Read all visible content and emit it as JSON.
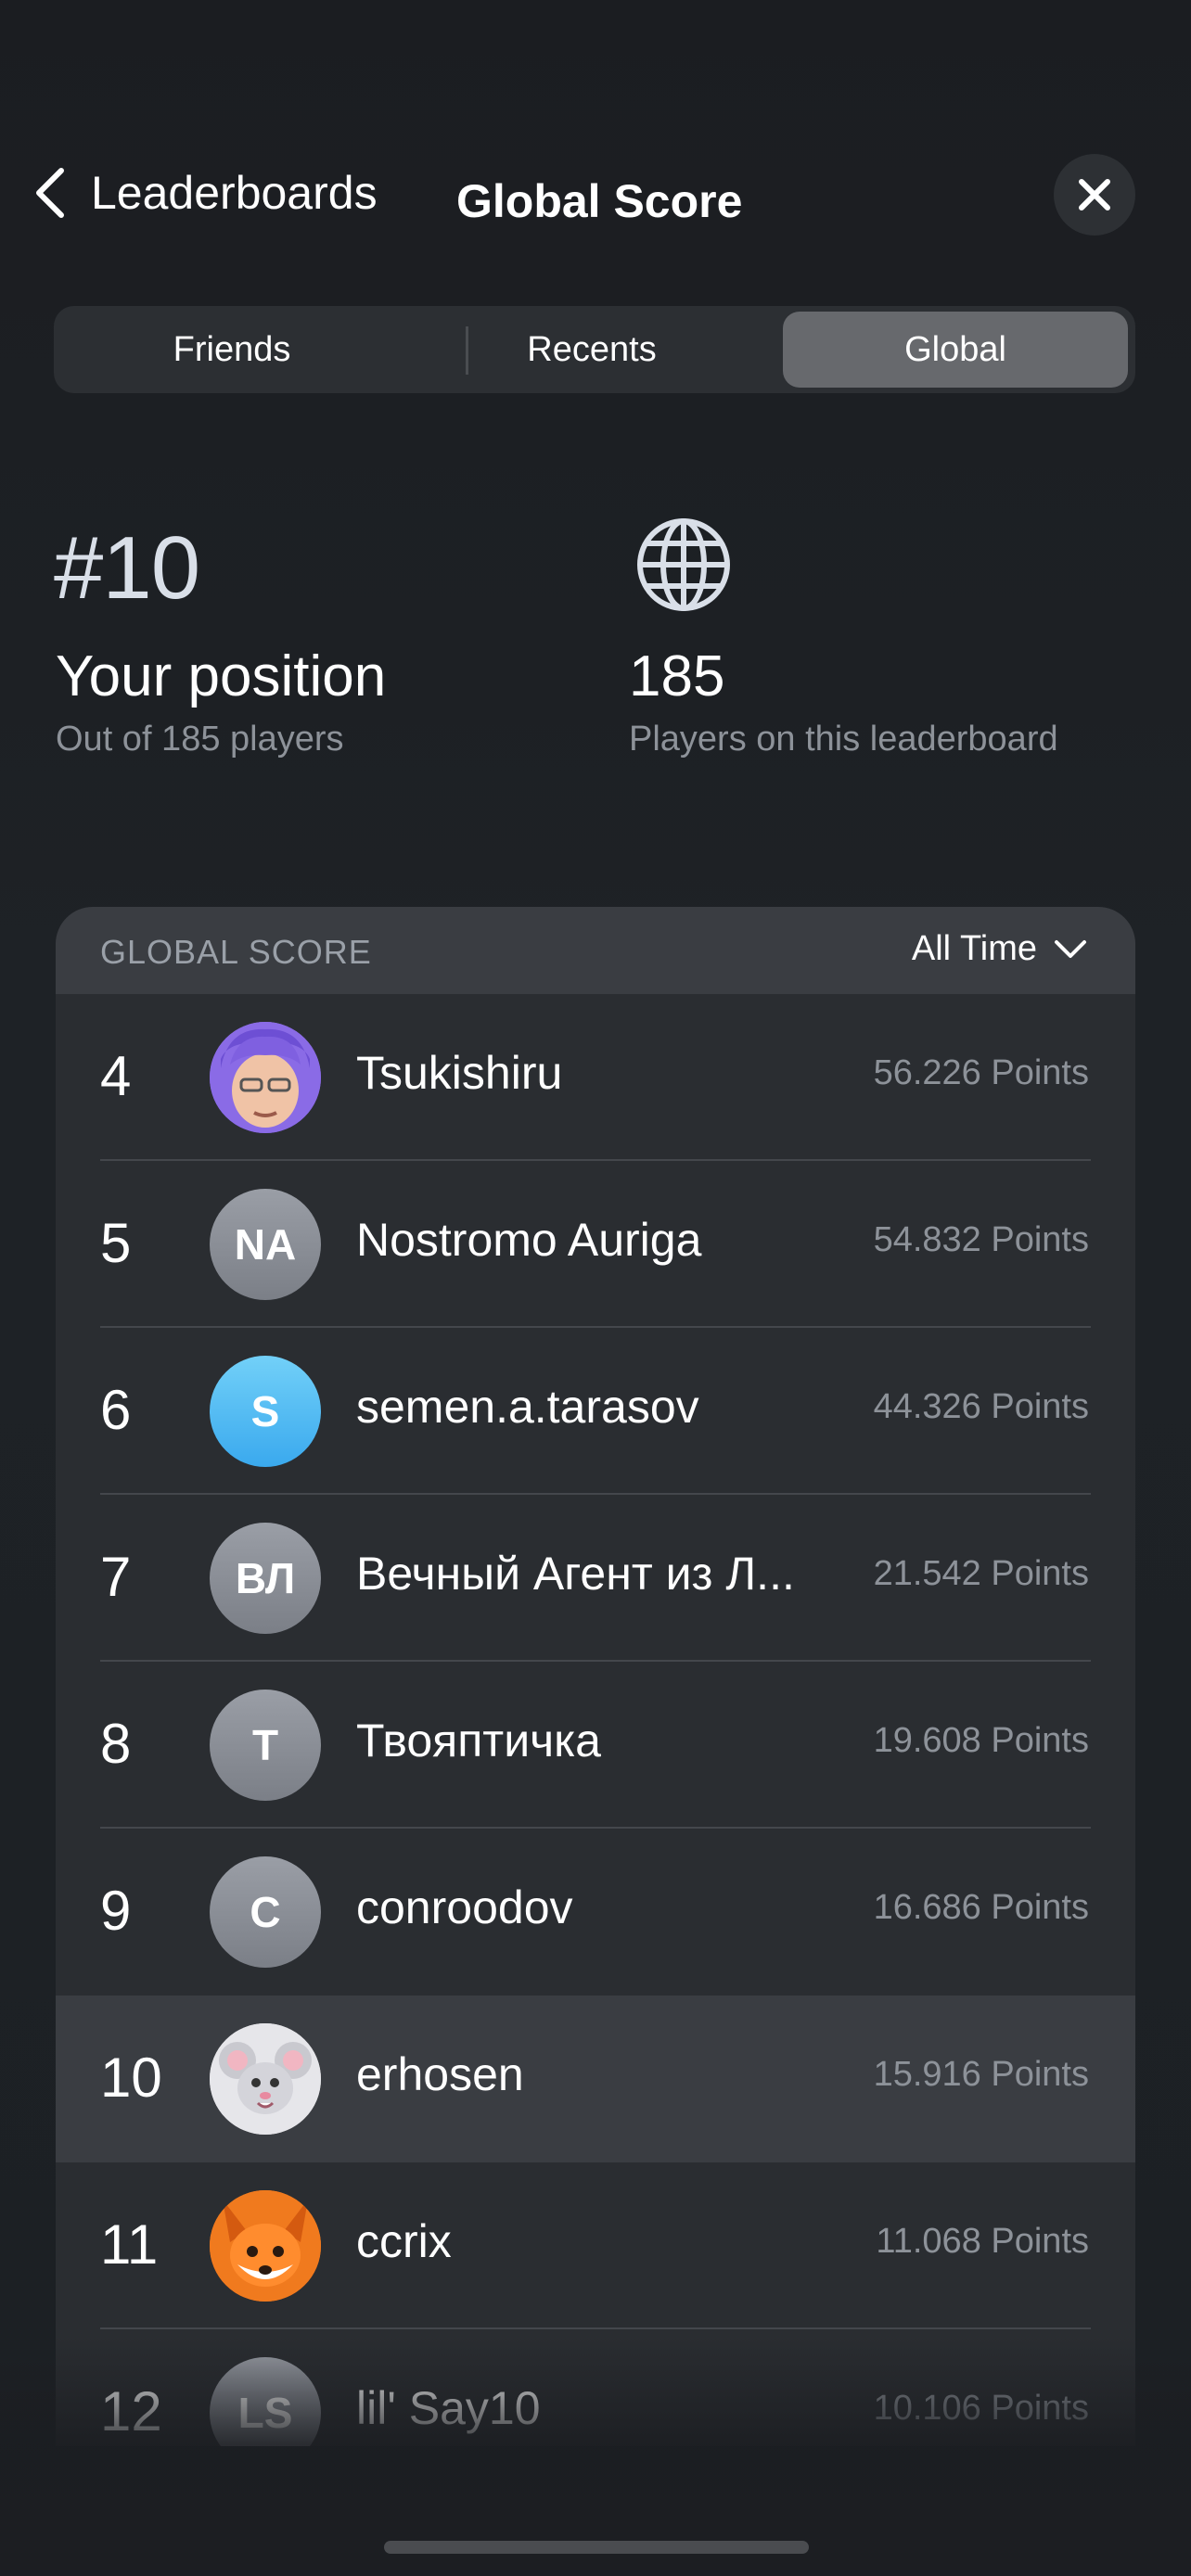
{
  "header": {
    "back_label": "Leaderboards",
    "title": "Global Score"
  },
  "tabs": [
    {
      "label": "Friends",
      "selected": false
    },
    {
      "label": "Recents",
      "selected": false
    },
    {
      "label": "Global",
      "selected": true
    }
  ],
  "stats": {
    "rank": "#10",
    "rank_label": "Your position",
    "rank_sub": "Out of 185 players",
    "globe_icon": "globe-icon",
    "count": "185",
    "count_sub": "Players on this leaderboard"
  },
  "list": {
    "header_label": "GLOBAL SCORE",
    "filter_label": "All Time",
    "rows": [
      {
        "rank": "4",
        "avatar": "",
        "avatar_type": "memoji",
        "name": "Tsukishiru",
        "points": "56.226 Points"
      },
      {
        "rank": "5",
        "avatar": "NA",
        "avatar_type": "initials",
        "name": "Nostromo Auriga",
        "points": "54.832 Points"
      },
      {
        "rank": "6",
        "avatar": "S",
        "avatar_type": "initials-blue",
        "name": "semen.a.tarasov",
        "points": "44.326 Points"
      },
      {
        "rank": "7",
        "avatar": "ВЛ",
        "avatar_type": "initials",
        "name": "Вечный Агент из Л...",
        "points": "21.542 Points"
      },
      {
        "rank": "8",
        "avatar": "T",
        "avatar_type": "initials",
        "name": "Твояптичка",
        "points": "19.608 Points"
      },
      {
        "rank": "9",
        "avatar": "C",
        "avatar_type": "initials",
        "name": "conroodov",
        "points": "16.686 Points"
      },
      {
        "rank": "10",
        "avatar": "",
        "avatar_type": "mouse",
        "name": "erhosen",
        "points": "15.916 Points"
      },
      {
        "rank": "11",
        "avatar": "",
        "avatar_type": "fox",
        "name": "ccrix",
        "points": "11.068 Points"
      },
      {
        "rank": "12",
        "avatar": "LS",
        "avatar_type": "initials",
        "name": "lil' Say10",
        "points": "10.106 Points"
      }
    ]
  }
}
